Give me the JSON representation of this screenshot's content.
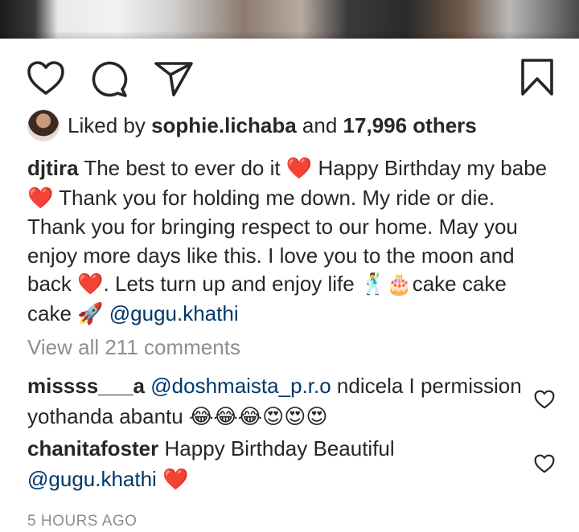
{
  "post": {
    "liked_by_prefix": "Liked by",
    "liked_by_user": "sophie.lichaba",
    "liked_by_and": "and",
    "likes_count": "17,996 others",
    "caption": {
      "username": "djtira",
      "text_1": "The best to ever do it",
      "emoji_1": "❤️",
      "text_2": "Happy Birthday my babe",
      "emoji_2": "❤️",
      "text_3": "Thank you for holding me down. My ride or die. Thank you for bringing respect to our home. May you enjoy more days like this. I love you to the moon and back",
      "emoji_3": "❤️",
      "text_4": ". Lets turn up and enjoy life",
      "emoji_4": "🕺🎂",
      "text_5": "cake cake cake",
      "emoji_5": "🚀",
      "mention": "@gugu.khathi"
    },
    "view_all_comments": "View all 211 comments",
    "comments": [
      {
        "username": "missss___a",
        "mention": "@doshmaista_p.r.o",
        "text": "ndicela I permission yothanda abantu",
        "emoji": "😂😂😂😍😍😍"
      },
      {
        "username": "chanitafoster",
        "text": "Happy Birthday Beautiful",
        "mention": "@gugu.khathi",
        "emoji": "❤️"
      }
    ],
    "timestamp": "5 HOURS AGO"
  },
  "icons": {
    "like": "heart-outline-icon",
    "comment": "comment-bubble-icon",
    "share": "paper-plane-icon",
    "save": "bookmark-icon"
  }
}
